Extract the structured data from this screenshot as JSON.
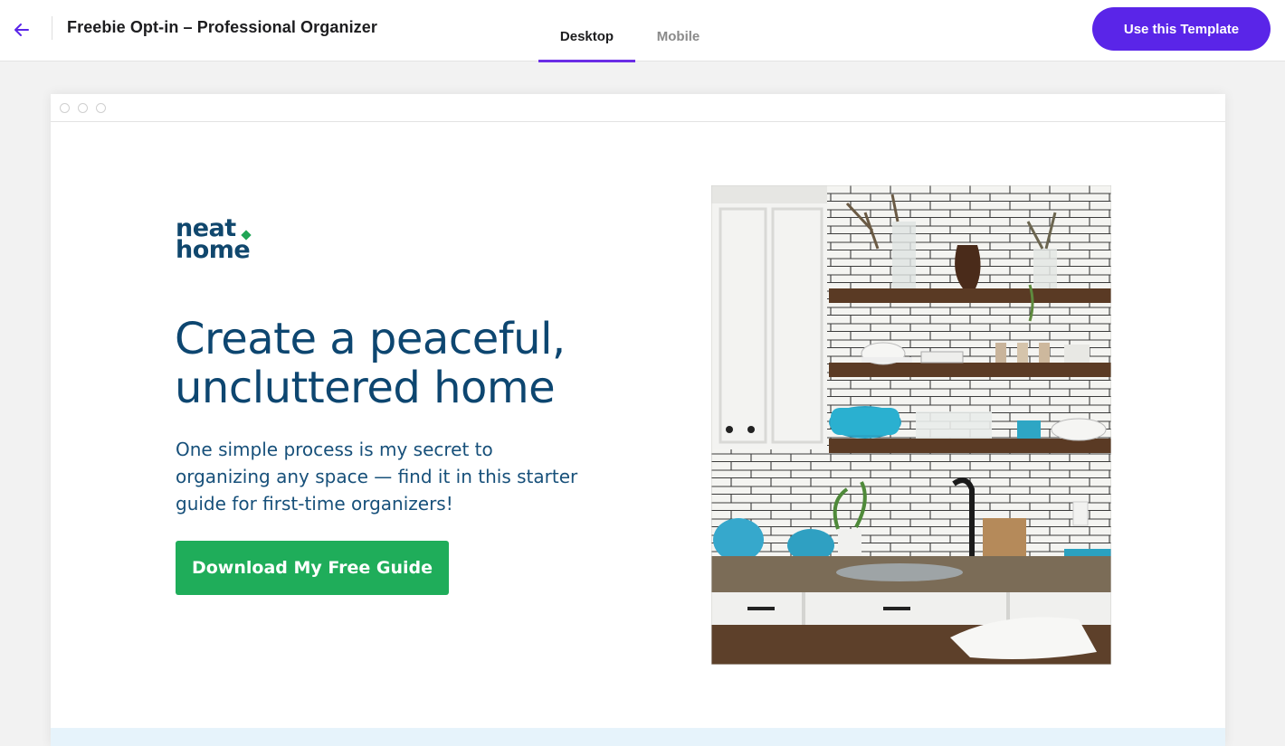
{
  "topbar": {
    "title": "Freebie Opt-in – Professional Organizer",
    "tabs": [
      {
        "label": "Desktop",
        "active": true
      },
      {
        "label": "Mobile",
        "active": false
      }
    ],
    "cta_label": "Use this Template"
  },
  "colors": {
    "accent": "#5a25e8",
    "brand_blue": "#0d4670",
    "brand_green": "#1fad5a"
  },
  "page": {
    "logo": {
      "line1": "neat",
      "line2": "home"
    },
    "headline": "Create a peaceful, uncluttered home",
    "subtext": "One simple process is my secret to organizing any space — find it in this starter guide for first-time organizers!",
    "cta_label": "Download My Free Guide",
    "hero_image": "kitchen-shelves-photo"
  },
  "icons": {
    "back": "arrow-left-icon"
  }
}
